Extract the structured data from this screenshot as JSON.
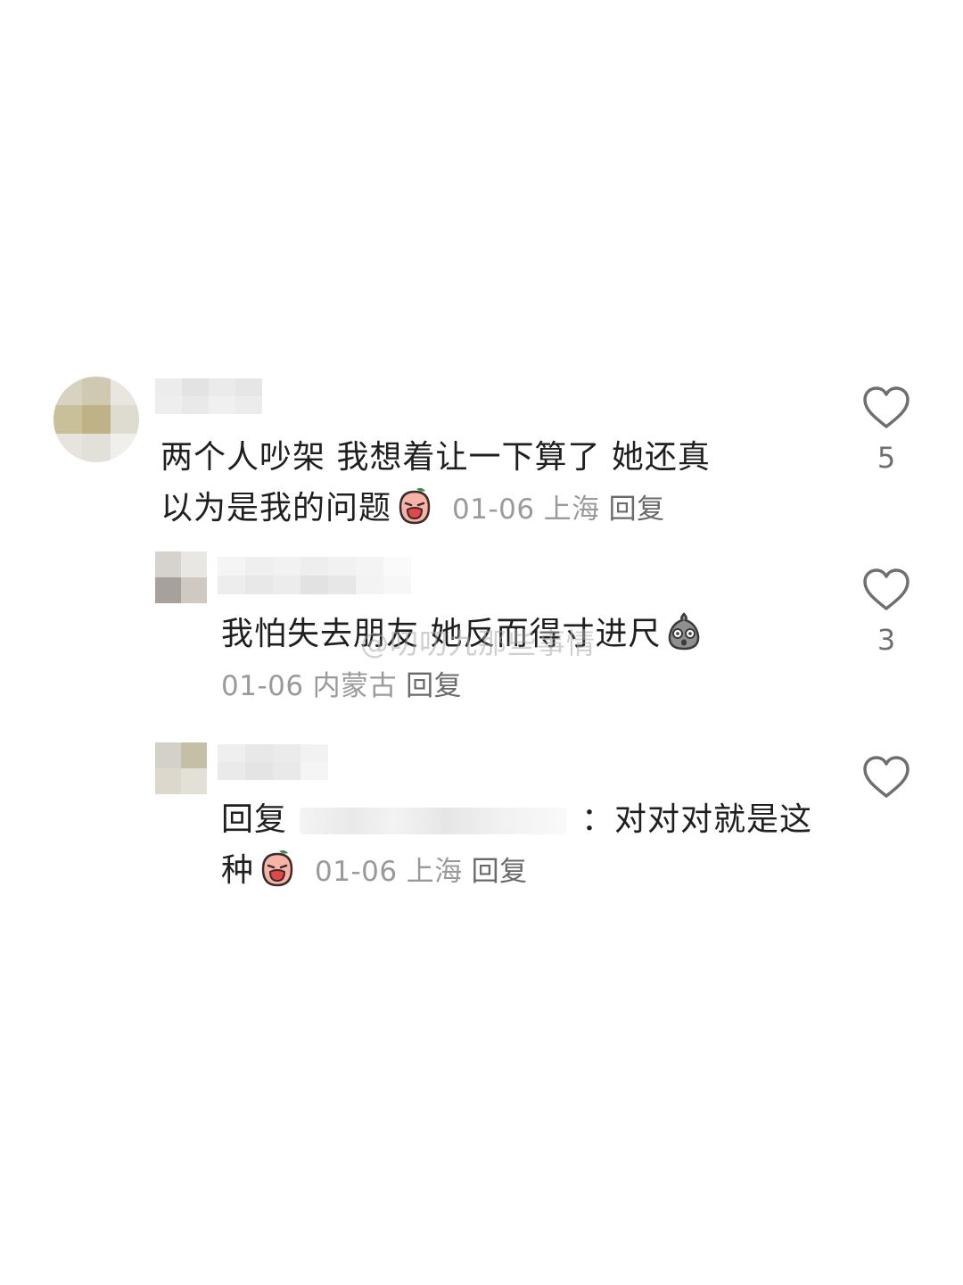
{
  "comments": [
    {
      "text_line1": "两个人吵架 我想着让一下算了 她还真",
      "text_line2": "以为是我的问题",
      "date": "01-06",
      "location": "上海",
      "reply_label": "回复",
      "likes": "5",
      "emoji": "crying-face-emoji"
    },
    {
      "text_line1": "我怕失去朋友 她反而得寸进尺",
      "date": "01-06",
      "location": "内蒙古",
      "reply_label": "回复",
      "likes": "3",
      "emoji": "shocked-grey-face-emoji"
    },
    {
      "reply_prefix": "回复",
      "colon": "：",
      "text_after": "对对对就是这",
      "text_line2": "种",
      "date": "01-06",
      "location": "上海",
      "reply_label": "回复",
      "likes": "",
      "emoji": "crying-face-emoji"
    }
  ],
  "watermark": "@叨叨九那些事情",
  "icons": {
    "like": "heart-outline-icon"
  },
  "colors": {
    "text": "#1f1f1f",
    "meta": "#9a9a9a",
    "icon": "#6f6f6f",
    "background": "#ffffff"
  }
}
